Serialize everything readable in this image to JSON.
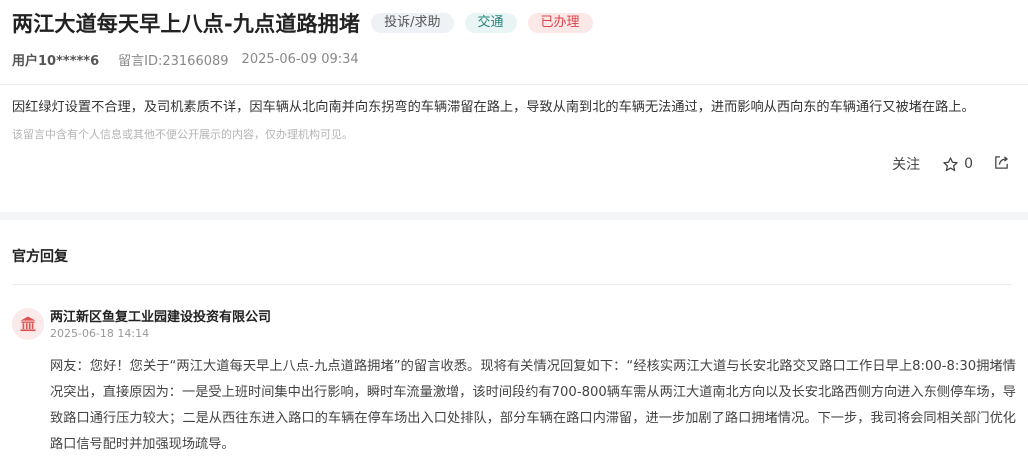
{
  "message": {
    "title": "两江大道每天早上八点-九点道路拥堵",
    "tags": {
      "category": "投诉/求助",
      "domain": "交通",
      "status": "已办理"
    },
    "user": "用户10*****6",
    "message_id": "留言ID:23166089",
    "time": "2025-06-09 09:34",
    "content": "因红绿灯设置不合理，及司机素质不详，因车辆从北向南并向东拐弯的车辆滞留在路上，导致从南到北的车辆无法通过，进而影响从西向东的车辆通行又被堵在路上。",
    "privacy_note": "该留言中含有个人信息或其他不便公开展示的内容，仅办理机构可见。"
  },
  "actions": {
    "follow_label": "关注",
    "like_count": "0",
    "icons": [
      "star-icon",
      "share-icon"
    ]
  },
  "reply": {
    "section_title": "官方回复",
    "org_name": "两江新区鱼复工业园建设投资有限公司",
    "org_icon": "government-building-icon",
    "time": "2025-06-18 14:14",
    "text": "网友：您好！您关于“两江大道每天早上八点-九点道路拥堵”的留言收悉。现将有关情况回复如下：“经核实两江大道与长安北路交叉路口工作日早上8:00-8:30拥堵情况突出，直接原因为：一是受上班时间集中出行影响，瞬时车流量激增，该时间段约有700-800辆车需从两江大道南北方向以及长安北路西侧方向进入东侧停车场，导致路口通行压力较大；二是从西往东进入路口的车辆在停车场出入口处排队，部分车辆在路口内滞留，进一步加剧了路口拥堵情况。下一步，我司将会同相关部门优化路口信号配时并加强现场疏导。"
  },
  "colors": {
    "tag_category_bg": "#eef1f6",
    "tag_domain_bg": "#e8f5f4",
    "tag_domain_text": "#29837b",
    "tag_status_bg": "#fde8e8",
    "tag_status_text": "#d9434a",
    "org_icon_color": "#d9534f"
  }
}
